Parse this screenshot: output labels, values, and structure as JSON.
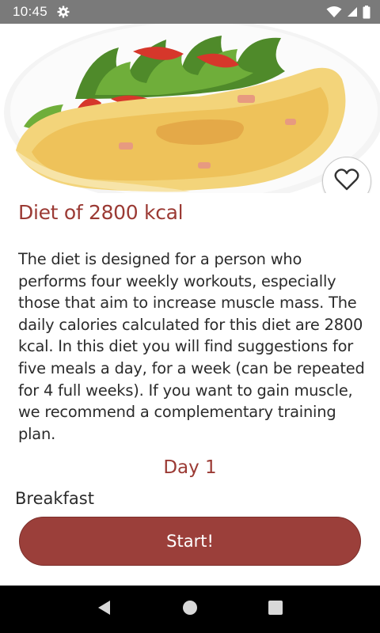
{
  "status_bar": {
    "time": "10:45",
    "icons": [
      "gear-icon",
      "wifi-icon",
      "signal-icon",
      "battery-icon"
    ]
  },
  "hero": {
    "image": "omelette-with-salad",
    "favorite_icon": "heart-outline-icon"
  },
  "diet": {
    "title": "Diet of 2800 kcal",
    "description": "The diet is designed for a person who performs four weekly workouts, especially those that aim to increase muscle mass. The daily calories calculated for this diet are 2800 kcal. In this diet you will find suggestions for five meals a day, for a week (can be repeated for 4 full weeks). If you want to gain muscle, we recommend a complementary training plan."
  },
  "plan": {
    "day_label": "Day 1",
    "meal_label": "Breakfast"
  },
  "actions": {
    "start_label": "Start!"
  },
  "nav_bar": {
    "icons": [
      "back-icon",
      "home-icon",
      "recents-icon"
    ]
  },
  "colors": {
    "accent": "#9b3a34",
    "button": "#9b3f3a",
    "text": "#2b2b2b",
    "status_bar": "#7a7a7a"
  }
}
